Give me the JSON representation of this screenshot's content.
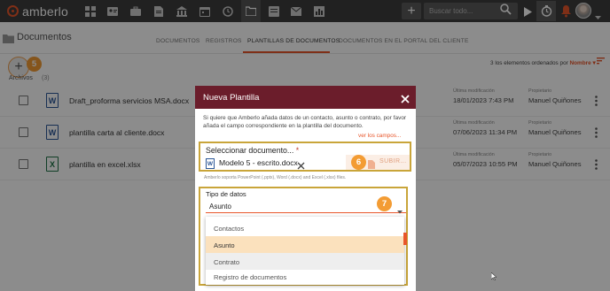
{
  "app": {
    "brand": "amberlo"
  },
  "topbar": {
    "search_placeholder": "Buscar todo...",
    "icons": [
      "dashboard-icon",
      "users-icon",
      "briefcase-icon",
      "document-icon",
      "bank-icon",
      "calendar-icon",
      "history-icon",
      "folder-icon",
      "invoice-icon",
      "mail-icon",
      "chart-icon"
    ],
    "plus_label": "+"
  },
  "page": {
    "title": "Documentos"
  },
  "tabs": [
    {
      "label": "DOCUMENTOS",
      "active": false
    },
    {
      "label": "REGISTROS",
      "active": false
    },
    {
      "label": "PLANTILLAS DE DOCUMENTOS",
      "active": true
    },
    {
      "label": "DOCUMENTOS EN EL PORTAL DEL CLIENTE",
      "active": false
    }
  ],
  "toolbar": {
    "add_label": "+",
    "step_add": "5"
  },
  "list": {
    "section_label": "Archivos",
    "section_count": "(3)",
    "sort_prefix": "3 los elementos ordenados por",
    "sort_field": "Nombre",
    "sort_caret": "▾",
    "files": [
      {
        "name": "Draft_proforma servicios MSA.docx",
        "type_letter": "W",
        "kind": "word",
        "mod_label": "Última modificación",
        "mod_date": "18/01/2023 7:43 PM",
        "owner_label": "Propietario",
        "owner": "Manuel Quiñones"
      },
      {
        "name": "plantilla carta al cliente.docx",
        "type_letter": "W",
        "kind": "word",
        "mod_label": "Última modificación",
        "mod_date": "07/06/2023 11:34 PM",
        "owner_label": "Propietario",
        "owner": "Manuel Quiñones"
      },
      {
        "name": "plantilla en excel.xlsx",
        "type_letter": "X",
        "kind": "excel",
        "mod_label": "Última modificación",
        "mod_date": "05/07/2023 10:55 PM",
        "owner_label": "Propietario",
        "owner": "Manuel Quiñones"
      }
    ]
  },
  "modal": {
    "title": "Nueva Plantilla",
    "intro": "Si quiere que Amberlo añada datos de un contacto, asunto o contrato, por favor añada el campo correspondiente en la plantilla del documento.",
    "ver_campos": "ver los campos...",
    "select_doc_label": "Seleccionar documento...",
    "required_mark": "*",
    "selected_file": "Modelo 5 - escrito.docx",
    "selected_file_letter": "W",
    "step_upload": "6",
    "upload_label": "SUBIR...",
    "support_text": "Amberlo soporta PowerPoint (.pptx), Word (.docx) and Excel (.xlsx) files.",
    "tipo_label": "Tipo de datos",
    "tipo_value": "Asunto",
    "step_tipo": "7",
    "options": [
      {
        "label": "Contactos",
        "state": "normal"
      },
      {
        "label": "Asunto",
        "state": "selected"
      },
      {
        "label": "Contrato",
        "state": "hover"
      }
    ],
    "last_option": "Registro de documentos"
  },
  "colors": {
    "accent": "#e8562b",
    "modal_header": "#6b1d2b",
    "highlight": "#c9a53a",
    "badge": "#f39c34",
    "selected_option": "#fbe1bd"
  }
}
